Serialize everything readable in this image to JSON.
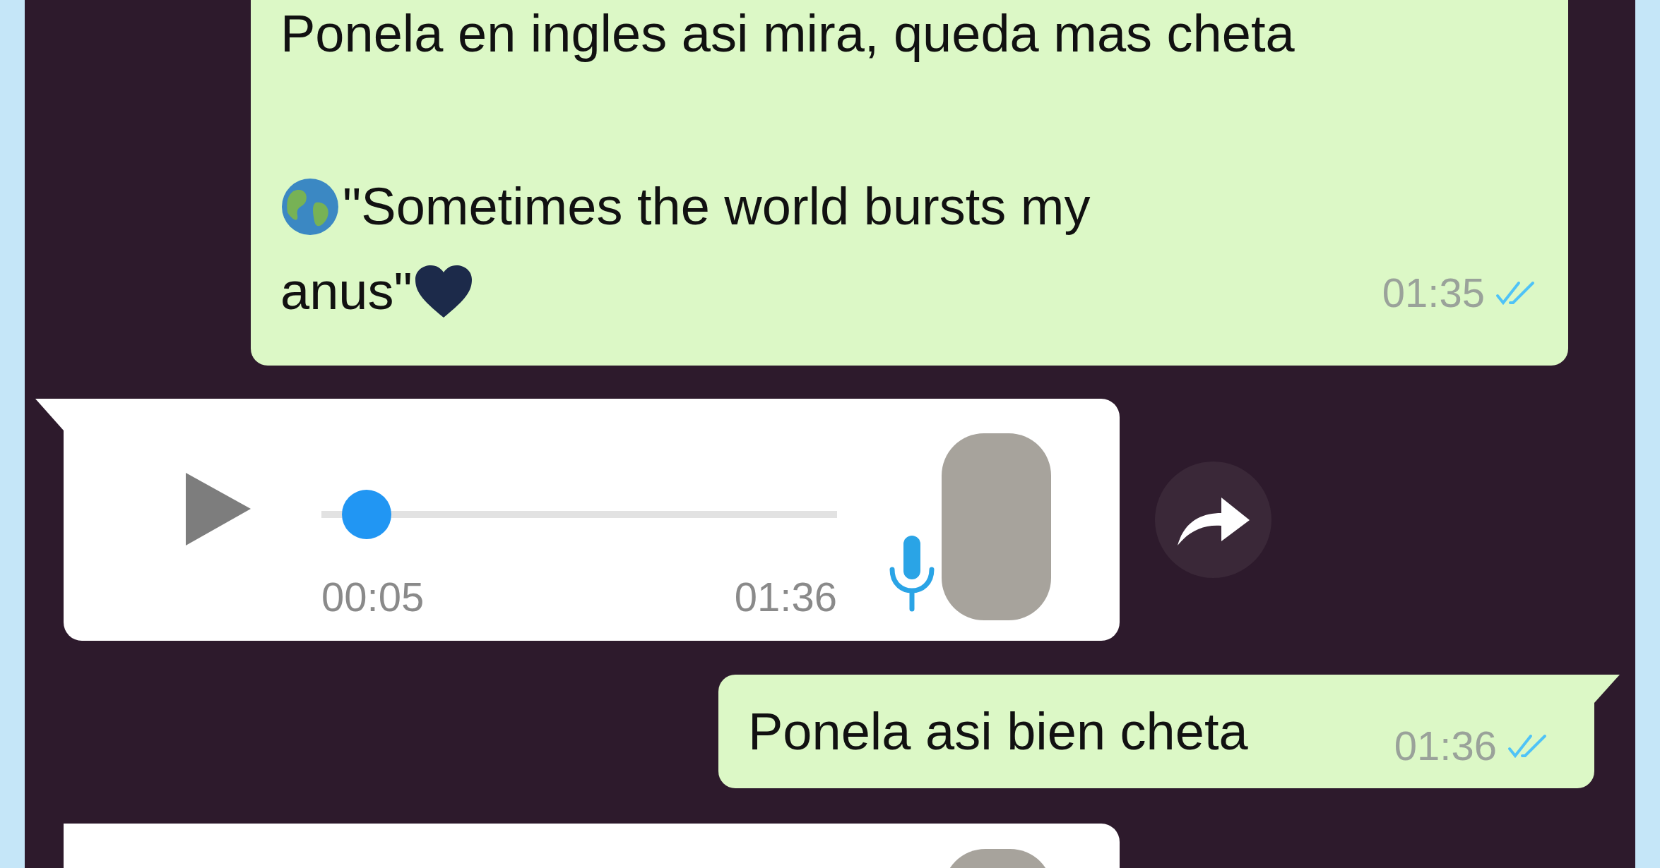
{
  "messages": [
    {
      "kind": "text",
      "lines": [
        "Ponela en ingles asi mira, queda mas cheta",
        "\"Sometimes the world bursts my",
        "anus\""
      ],
      "time": "01:35",
      "read": true
    },
    {
      "kind": "voice",
      "level": 0.04,
      "position": "00:05",
      "time": "01:36",
      "listened": true
    },
    {
      "kind": "text",
      "lines": [
        "Ponela asi bien cheta"
      ],
      "time": "01:36",
      "read": true
    },
    {
      "kind": "partial"
    }
  ]
}
